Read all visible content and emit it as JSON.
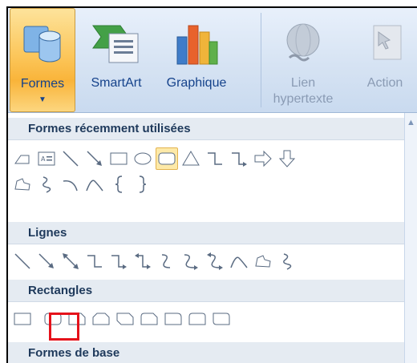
{
  "ribbon": {
    "buttons": [
      {
        "label": "Formes",
        "icon": "shapes-icon",
        "active": true,
        "dropdown": true
      },
      {
        "label": "SmartArt",
        "icon": "smartart-icon"
      },
      {
        "label": "Graphique",
        "icon": "chart-icon"
      },
      {
        "label": "Lien hypertexte",
        "icon": "hyperlink-icon",
        "disabled": true
      },
      {
        "label": "Action",
        "icon": "action-icon",
        "disabled": true
      }
    ]
  },
  "gallery": {
    "categories": [
      {
        "title": "Formes récemment utilisées",
        "rows": [
          [
            "line-corner",
            "textbox",
            "line",
            "arrow-line",
            "rectangle",
            "oval",
            "rounded-rectangle",
            "triangle",
            "elbow-connector",
            "elbow-arrow-connector",
            "right-arrow",
            "down-arrow"
          ],
          [
            "freeform",
            "scribble",
            "arc",
            "curve",
            "left-brace",
            "right-brace"
          ]
        ]
      },
      {
        "title": "Lignes",
        "rows": [
          [
            "line",
            "arrow-line",
            "double-arrow-line",
            "elbow-connector",
            "elbow-arrow-connector",
            "elbow-double-arrow-connector",
            "curved-connector",
            "curved-arrow-connector",
            "curved-double-arrow-connector",
            "curve",
            "freeform",
            "scribble"
          ]
        ]
      },
      {
        "title": "Rectangles",
        "rows": [
          [
            "rectangle",
            "rounded-rectangle",
            "snip-single-corner",
            "snip-same-side",
            "snip-diagonal",
            "snip-round-single",
            "round-single-corner",
            "round-same-side",
            "round-diagonal"
          ]
        ]
      },
      {
        "title": "Formes de base",
        "rows": []
      }
    ],
    "hovered_shape": "rounded-rectangle (recent)",
    "selected_annotation": "rounded-rectangle (Rectangles)"
  },
  "colors": {
    "accent_active": "#f9b43a",
    "header_text": "#1e395b",
    "ribbon_text": "#15428b",
    "annotation": "#e5121b"
  }
}
